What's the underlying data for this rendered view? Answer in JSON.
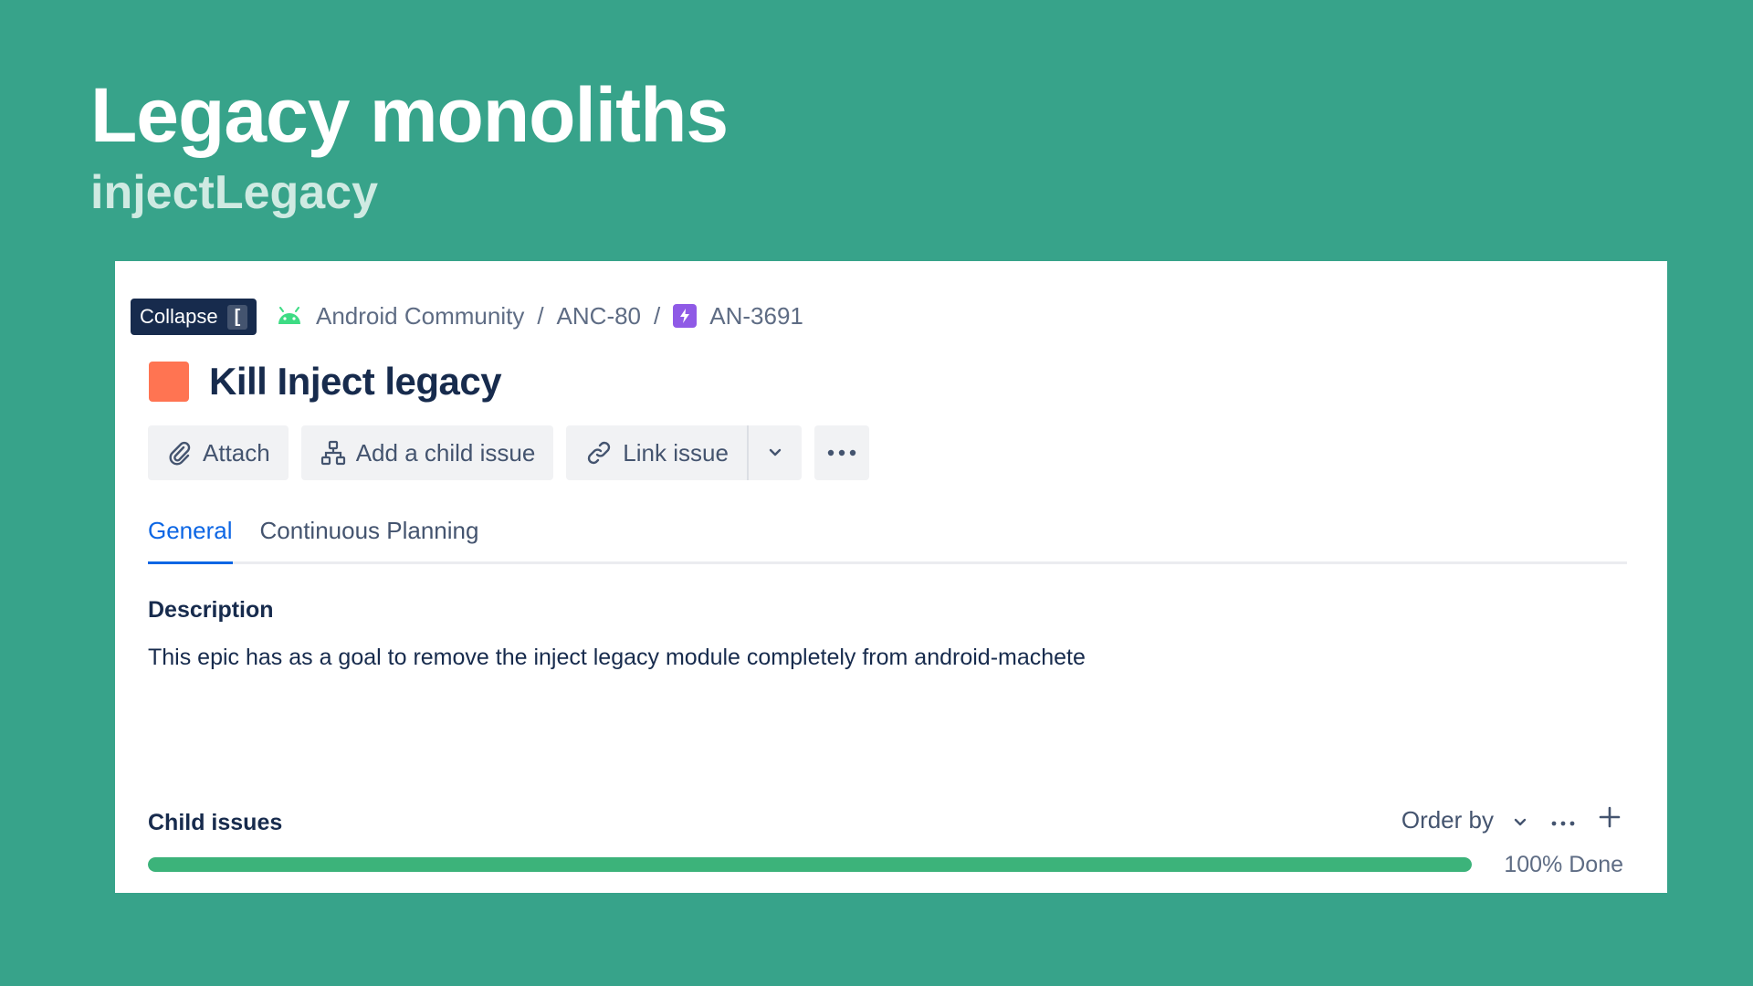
{
  "slide": {
    "title": "Legacy monoliths",
    "subtitle": "injectLegacy"
  },
  "tooltip": {
    "label": "Collapse",
    "key": "["
  },
  "breadcrumb": {
    "project": "Android Community",
    "parent": "ANC-80",
    "issue_key": "AN-3691",
    "separator": "/"
  },
  "issue": {
    "title": "Kill Inject legacy",
    "icon_color": "#FF7452"
  },
  "toolbar": {
    "attach_label": "Attach",
    "child_issue_label": "Add a child issue",
    "link_issue_label": "Link issue"
  },
  "tabs": [
    {
      "label": "General",
      "active": true
    },
    {
      "label": "Continuous Planning",
      "active": false
    }
  ],
  "description": {
    "label": "Description",
    "text": "This epic has as a goal to remove the inject legacy module completely from android-machete"
  },
  "child_issues": {
    "label": "Child issues",
    "order_by_label": "Order by",
    "progress_percent": 100,
    "progress_text": "100% Done"
  },
  "colors": {
    "background": "#37A38A",
    "accent": "#0C66E4",
    "progress": "#3CB37A",
    "epic": "#8F5AE6",
    "android": "#3DDC84"
  },
  "icons": {
    "project": "android-icon",
    "issue_type": "epic-lightning-icon",
    "attach": "paperclip-icon",
    "child_issue": "hierarchy-icon",
    "link": "link-icon",
    "caret": "chevron-down-icon",
    "more": "more-horizontal-icon",
    "add": "plus-icon"
  }
}
